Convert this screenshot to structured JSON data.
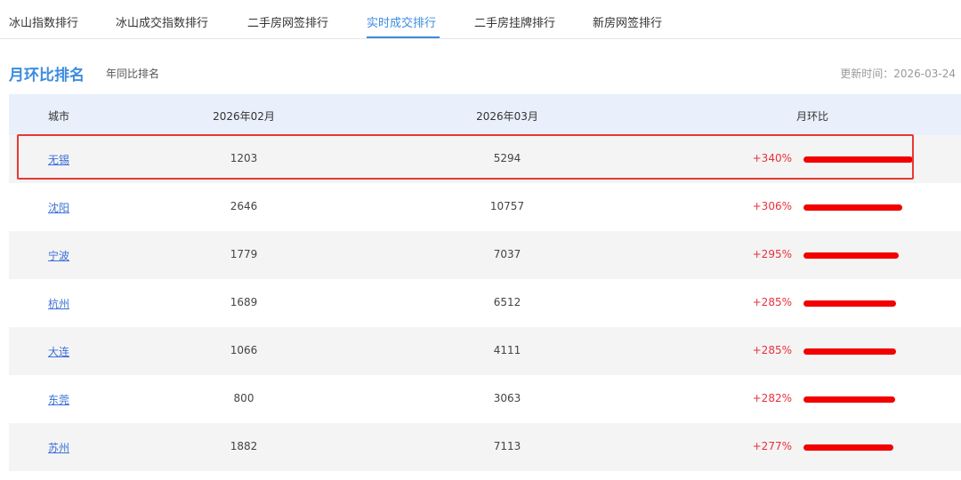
{
  "tabs": [
    {
      "label": "冰山指数排行",
      "active": false
    },
    {
      "label": "冰山成交指数排行",
      "active": false
    },
    {
      "label": "二手房网签排行",
      "active": false
    },
    {
      "label": "实时成交排行",
      "active": true
    },
    {
      "label": "二手房挂牌排行",
      "active": false
    },
    {
      "label": "新房网签排行",
      "active": false
    }
  ],
  "section": {
    "title": "月环比排名",
    "sub_tab": "年同比排名",
    "update_time": "更新时间：2026-03-24"
  },
  "table": {
    "headers": [
      "城市",
      "2026年02月",
      "2026年03月",
      "月环比"
    ],
    "rows": [
      {
        "city": "无锡",
        "feb": "1203",
        "mar": "5294",
        "mom": "+340%",
        "mom_value": 340
      },
      {
        "city": "沈阳",
        "feb": "2646",
        "mar": "10757",
        "mom": "+306%",
        "mom_value": 306
      },
      {
        "city": "宁波",
        "feb": "1779",
        "mar": "7037",
        "mom": "+295%",
        "mom_value": 295
      },
      {
        "city": "杭州",
        "feb": "1689",
        "mar": "6512",
        "mom": "+285%",
        "mom_value": 285
      },
      {
        "city": "大连",
        "feb": "1066",
        "mar": "4111",
        "mom": "+285%",
        "mom_value": 285
      },
      {
        "city": "东莞",
        "feb": "800",
        "mar": "3063",
        "mom": "+282%",
        "mom_value": 282
      },
      {
        "city": "苏州",
        "feb": "1882",
        "mar": "7113",
        "mom": "+277%",
        "mom_value": 277
      }
    ]
  },
  "colors": {
    "accent": "#3c8ce0",
    "bar": "#f20000",
    "positive_text": "#e8313b",
    "highlight_border": "#e53935"
  }
}
